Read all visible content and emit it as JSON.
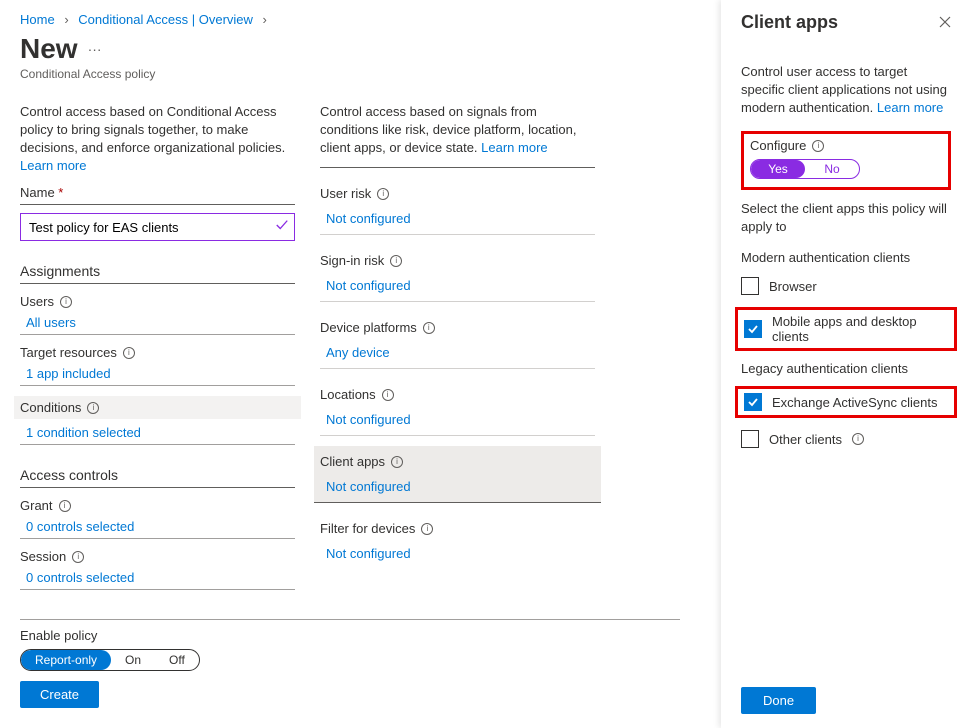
{
  "breadcrumb": {
    "home": "Home",
    "mid": "Conditional Access | Overview"
  },
  "page": {
    "title": "New",
    "subtitle": "Conditional Access policy"
  },
  "col1": {
    "desc": "Control access based on Conditional Access policy to bring signals together, to make decisions, and enforce organizational policies.",
    "learn_more": "Learn more",
    "name_label": "Name",
    "name_value": "Test policy for EAS clients",
    "assignments_head": "Assignments",
    "users_label": "Users",
    "users_value": "All users",
    "target_label": "Target resources",
    "target_value": "1 app included",
    "conditions_label": "Conditions",
    "conditions_value": "1 condition selected",
    "access_head": "Access controls",
    "grant_label": "Grant",
    "grant_value": "0 controls selected",
    "session_label": "Session",
    "session_value": "0 controls selected"
  },
  "col2": {
    "desc": "Control access based on signals from conditions like risk, device platform, location, client apps, or device state.",
    "learn_more": "Learn more",
    "items": [
      {
        "label": "User risk",
        "value": "Not configured"
      },
      {
        "label": "Sign-in risk",
        "value": "Not configured"
      },
      {
        "label": "Device platforms",
        "value": "Any device"
      },
      {
        "label": "Locations",
        "value": "Not configured"
      },
      {
        "label": "Client apps",
        "value": "Not configured"
      },
      {
        "label": "Filter for devices",
        "value": "Not configured"
      }
    ]
  },
  "footer": {
    "enable_label": "Enable policy",
    "opt1": "Report-only",
    "opt2": "On",
    "opt3": "Off",
    "create": "Create"
  },
  "panel": {
    "title": "Client apps",
    "desc": "Control user access to target specific client applications not using modern authentication.",
    "learn_more": "Learn more",
    "configure_label": "Configure",
    "yes": "Yes",
    "no": "No",
    "select_text": "Select the client apps this policy will apply to",
    "group1": "Modern authentication clients",
    "cb1": "Browser",
    "cb2": "Mobile apps and desktop clients",
    "group2": "Legacy authentication clients",
    "cb3": "Exchange ActiveSync clients",
    "cb4": "Other clients",
    "done": "Done"
  }
}
